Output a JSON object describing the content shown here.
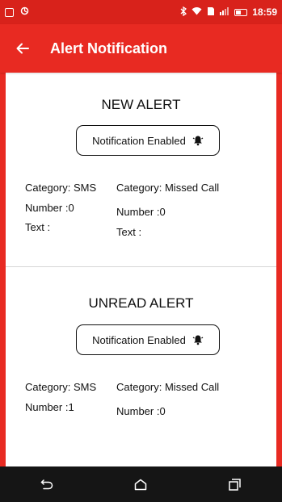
{
  "status_bar": {
    "time": "18:59",
    "left_icons": [
      "screen-mirror-icon",
      "sync-icon"
    ],
    "right_icons": [
      "bluetooth-icon",
      "wifi-icon",
      "sim-icon",
      "signal-icon",
      "battery-icon"
    ]
  },
  "app_bar": {
    "title": "Alert Notification",
    "back_icon": "arrow-left-icon",
    "color": "#e82a22"
  },
  "new_alert": {
    "title": "NEW ALERT",
    "button_label": "Notification Enabled",
    "sms": {
      "category": "Category: SMS",
      "number": "Number :0",
      "text": "Text :"
    },
    "missed_call": {
      "category": "Category: Missed Call",
      "number": "Number :0",
      "text": "Text :"
    }
  },
  "unread_alert": {
    "title": "UNREAD ALERT",
    "button_label": "Notification Enabled",
    "sms": {
      "category": "Category: SMS",
      "number": "Number :1"
    },
    "missed_call": {
      "category": "Category: Missed Call",
      "number": "Number :0"
    }
  },
  "nav_bar": {
    "buttons": [
      "back-nav-icon",
      "home-icon",
      "recent-apps-icon"
    ]
  }
}
